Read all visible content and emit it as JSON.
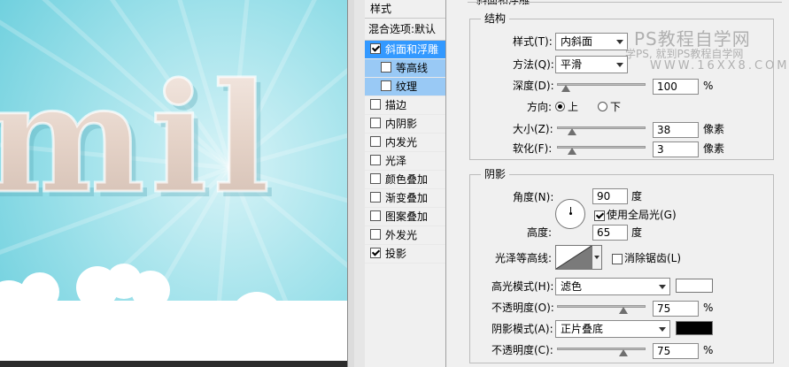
{
  "canvas": {
    "text": "mil"
  },
  "styles_panel": {
    "title": "样式",
    "blend_default": "混合选项:默认",
    "items": [
      {
        "label": "斜面和浮雕",
        "checked": true,
        "selected": true,
        "sub": false
      },
      {
        "label": "等高线",
        "checked": false,
        "selected": false,
        "sub": true
      },
      {
        "label": "纹理",
        "checked": false,
        "selected": false,
        "sub": true
      },
      {
        "label": "描边",
        "checked": false,
        "selected": false,
        "sub": false
      },
      {
        "label": "内阴影",
        "checked": false,
        "selected": false,
        "sub": false
      },
      {
        "label": "内发光",
        "checked": false,
        "selected": false,
        "sub": false
      },
      {
        "label": "光泽",
        "checked": false,
        "selected": false,
        "sub": false
      },
      {
        "label": "颜色叠加",
        "checked": false,
        "selected": false,
        "sub": false
      },
      {
        "label": "渐变叠加",
        "checked": false,
        "selected": false,
        "sub": false
      },
      {
        "label": "图案叠加",
        "checked": false,
        "selected": false,
        "sub": false
      },
      {
        "label": "外发光",
        "checked": false,
        "selected": false,
        "sub": false
      },
      {
        "label": "投影",
        "checked": true,
        "selected": false,
        "sub": false
      }
    ]
  },
  "bevel": {
    "panel_title": "斜面和浮雕",
    "structure": {
      "title": "结构",
      "style_label": "样式(T):",
      "style_value": "内斜面",
      "technique_label": "方法(Q):",
      "technique_value": "平滑",
      "depth_label": "深度(D):",
      "depth_value": "100",
      "depth_unit": "%",
      "direction_label": "方向:",
      "direction_up": "上",
      "direction_down": "下",
      "size_label": "大小(Z):",
      "size_value": "38",
      "size_unit": "像素",
      "soften_label": "软化(F):",
      "soften_value": "3",
      "soften_unit": "像素"
    },
    "shading": {
      "title": "阴影",
      "angle_label": "角度(N):",
      "angle_value": "90",
      "angle_unit": "度",
      "global_light_label": "使用全局光(G)",
      "altitude_label": "高度:",
      "altitude_value": "65",
      "altitude_unit": "度",
      "gloss_contour_label": "光泽等高线:",
      "anti_alias_label": "消除锯齿(L)",
      "highlight_mode_label": "高光模式(H):",
      "highlight_mode_value": "滤色",
      "highlight_color": "#ffffff",
      "highlight_opacity_label": "不透明度(O):",
      "highlight_opacity_value": "75",
      "highlight_opacity_unit": "%",
      "shadow_mode_label": "阴影模式(A):",
      "shadow_mode_value": "正片叠底",
      "shadow_color": "#000000",
      "shadow_opacity_label": "不透明度(C):",
      "shadow_opacity_value": "75",
      "shadow_opacity_unit": "%"
    }
  },
  "sliders": {
    "depth": 0.1,
    "size": 0.15,
    "soften": 0.15,
    "highlight_opacity": 0.75,
    "shadow_opacity": 0.75
  },
  "watermark": {
    "line1": "PS教程自学网",
    "line2": "学PS, 就到PS教程自学网",
    "line3": "WWW.16XX8.COM"
  }
}
